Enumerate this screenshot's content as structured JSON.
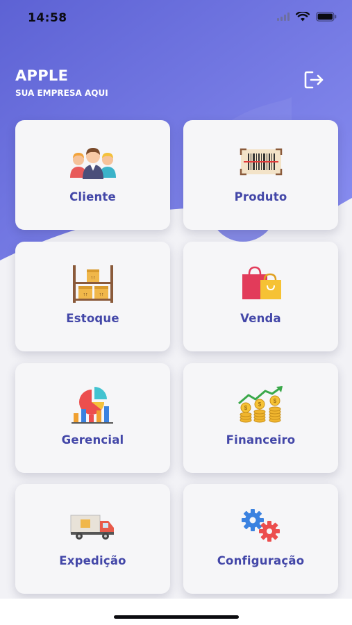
{
  "status_bar": {
    "time": "14:58"
  },
  "header": {
    "company_name": "APPLE",
    "company_subtitle": "SUA EMPRESA AQUI",
    "logout_icon": "logout-icon"
  },
  "menu": {
    "items": [
      {
        "label": "Cliente",
        "icon": "people-icon"
      },
      {
        "label": "Produto",
        "icon": "barcode-icon"
      },
      {
        "label": "Estoque",
        "icon": "shelf-boxes-icon"
      },
      {
        "label": "Venda",
        "icon": "shopping-bags-icon"
      },
      {
        "label": "Gerencial",
        "icon": "pie-bar-chart-icon"
      },
      {
        "label": "Financeiro",
        "icon": "coins-growth-icon"
      },
      {
        "label": "Expedição",
        "icon": "delivery-truck-icon"
      },
      {
        "label": "Configuração",
        "icon": "gears-icon"
      }
    ]
  },
  "colors": {
    "hero_gradient_start": "#6469d8",
    "hero_gradient_end": "#8a8ff0",
    "label_color": "#4347a8",
    "card_background": "#f6f6f8"
  }
}
